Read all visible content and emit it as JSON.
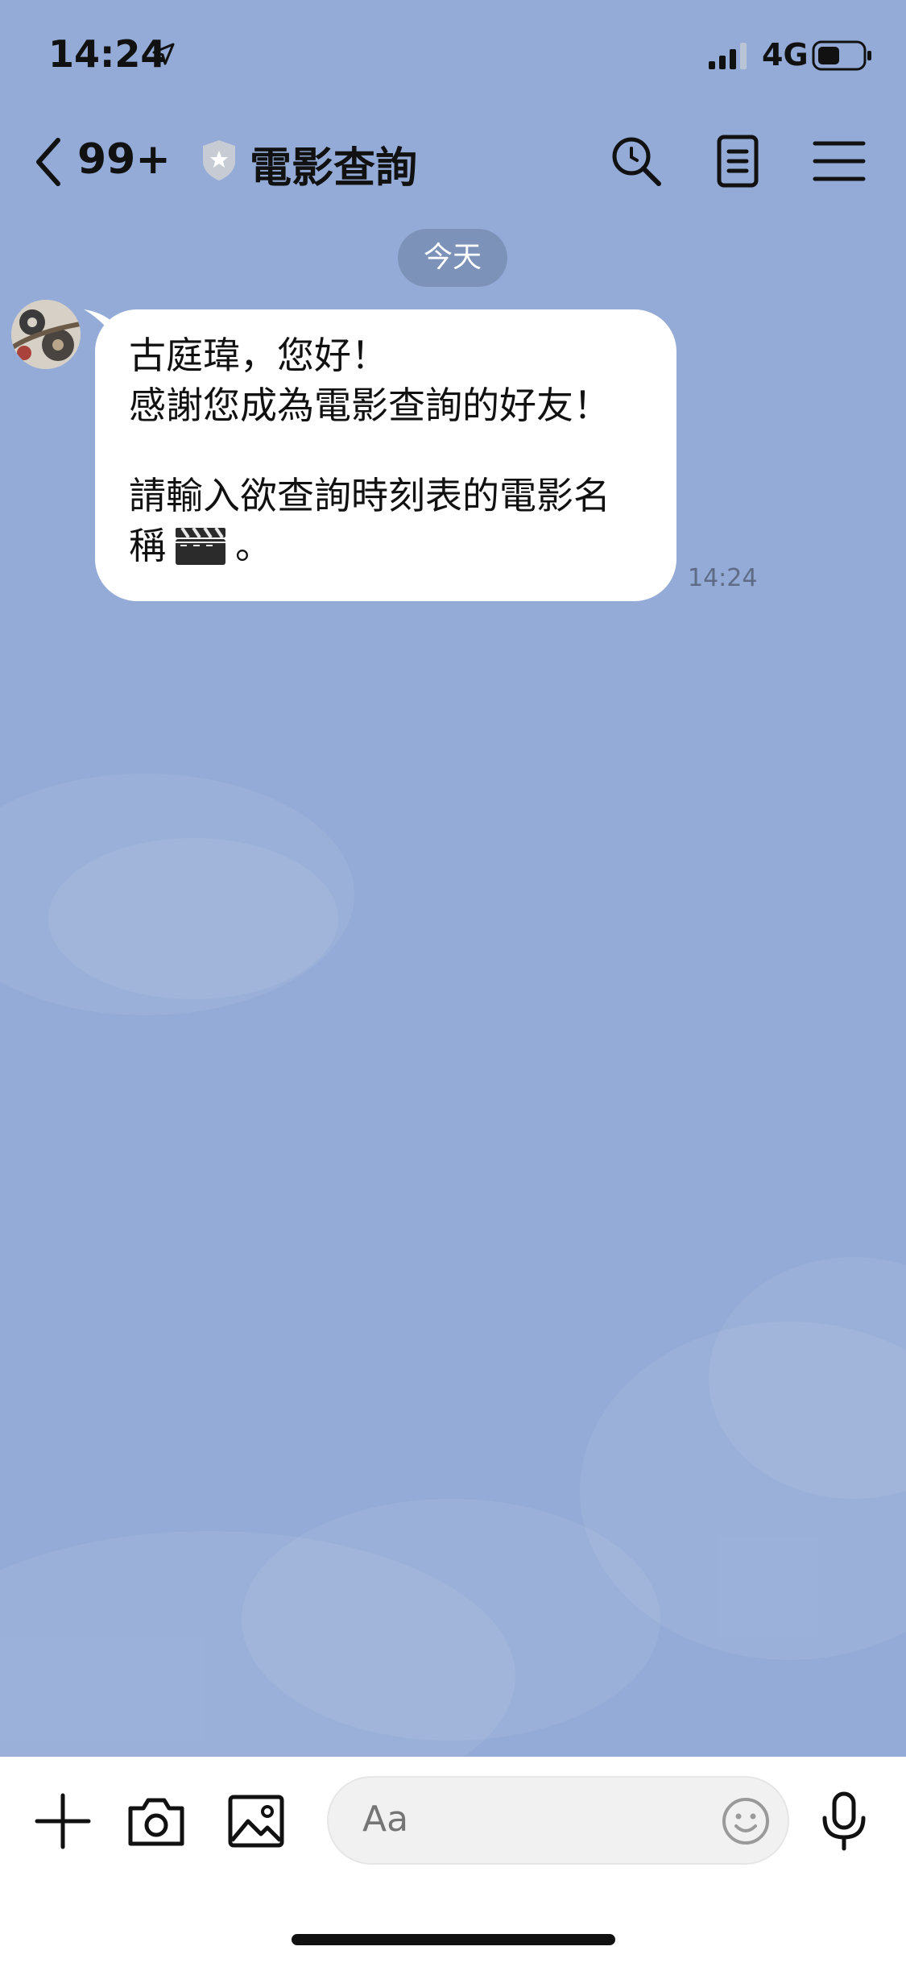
{
  "status_bar": {
    "time": "14:24",
    "network": "4G",
    "icons": [
      "location-arrow-icon",
      "signal-icon",
      "battery-icon"
    ]
  },
  "header": {
    "unread_count": "99+",
    "title": "電影查詢",
    "icons": [
      "back-chevron-icon",
      "shield-badge-icon",
      "search-icon",
      "notes-icon",
      "menu-icon"
    ]
  },
  "chat": {
    "date_label": "今天",
    "messages": [
      {
        "sender": "bot",
        "lines": [
          "古庭瑋，您好！",
          "感謝您成為電影查詢的好友！",
          "",
          "請輸入欲查詢時刻表的電影名",
          "稱"
        ],
        "trailing": "。",
        "emoji": "clapper-board-icon",
        "time": "14:24"
      }
    ]
  },
  "input_bar": {
    "placeholder": "Aa",
    "icons": [
      "plus-icon",
      "camera-icon",
      "image-icon",
      "emoji-icon",
      "microphone-icon"
    ]
  },
  "colors": {
    "chat_background": "#93abd6",
    "bubble": "#ffffff",
    "date_pill": "#7187ab",
    "timestamp": "#5e6c86"
  }
}
